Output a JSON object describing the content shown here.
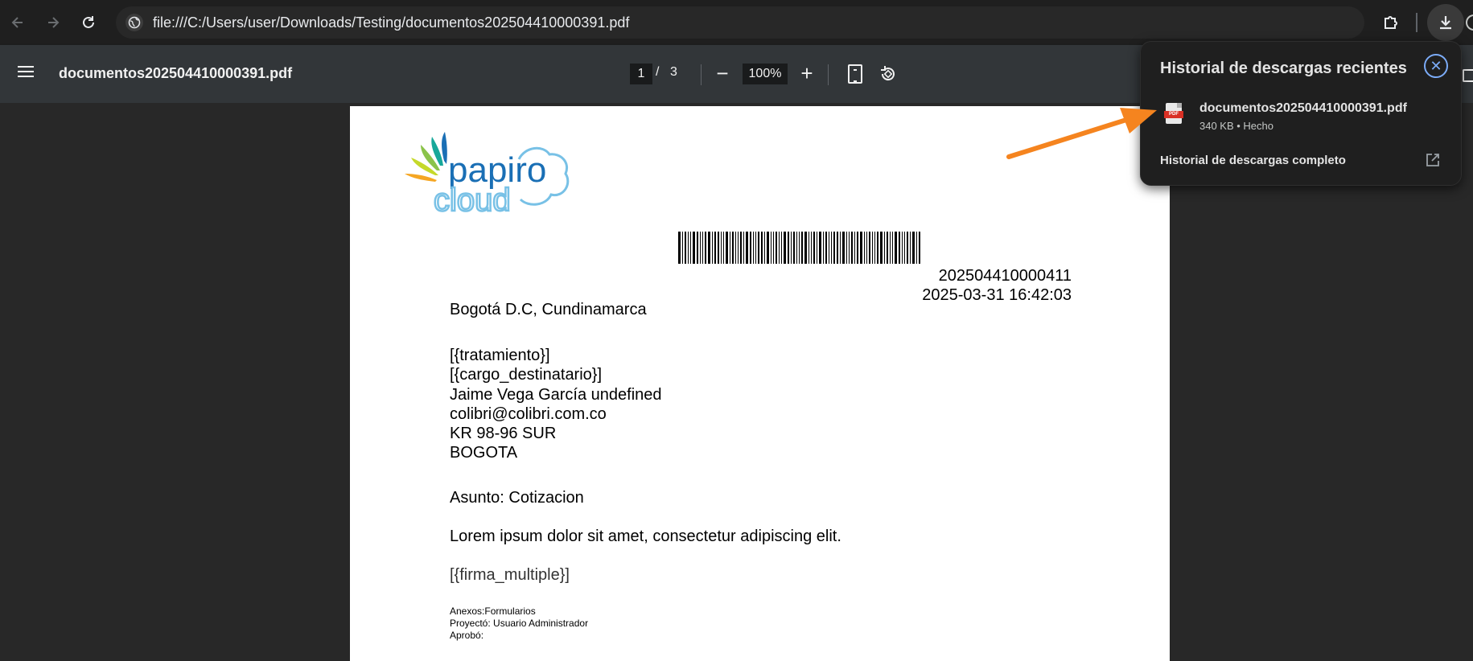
{
  "browser": {
    "url": "file:///C:/Users/user/Downloads/Testing/documentos202504410000391.pdf",
    "back_icon": "arrow-left-icon",
    "forward_icon": "arrow-right-icon",
    "reload_icon": "reload-icon",
    "extensions_icon": "puzzle-icon",
    "download_icon": "download-icon"
  },
  "pdf_toolbar": {
    "title": "documentos202504410000391.pdf",
    "current_page": "1",
    "page_separator": "/",
    "total_pages": "3",
    "zoom": "100%",
    "zoom_out_label": "−",
    "zoom_in_label": "+"
  },
  "document": {
    "logo_text_top": "papiro",
    "logo_text_bottom": "cloud",
    "radicado": "202504410000411",
    "fecha": "2025-03-31 16:42:03",
    "ciudad": "Bogotá D.C, Cundinamarca",
    "destinatario": [
      "[{tratamiento}]",
      "[{cargo_destinatario}]",
      "Jaime Vega García undefined",
      "colibri@colibri.com.co",
      "KR 98-96 SUR",
      "BOGOTA"
    ],
    "asunto": "Asunto: Cotizacion",
    "cuerpo": "Lorem ipsum dolor sit amet, consectetur adipiscing elit.",
    "firma": "[{firma_multiple}]",
    "anexos": "Anexos:Formularios",
    "proyecto": "Proyectó: Usuario Administrador",
    "aprobo": "Aprobó:"
  },
  "downloads_panel": {
    "heading": "Historial de descargas recientes",
    "file_name": "documentos202504410000391.pdf",
    "file_meta": "340 KB • Hecho",
    "file_badge": "PDF",
    "full_history": "Historial de descargas completo",
    "close_label": "✕"
  },
  "colors": {
    "annotation_arrow": "#f5841f",
    "close_accent": "#7cacf8"
  }
}
